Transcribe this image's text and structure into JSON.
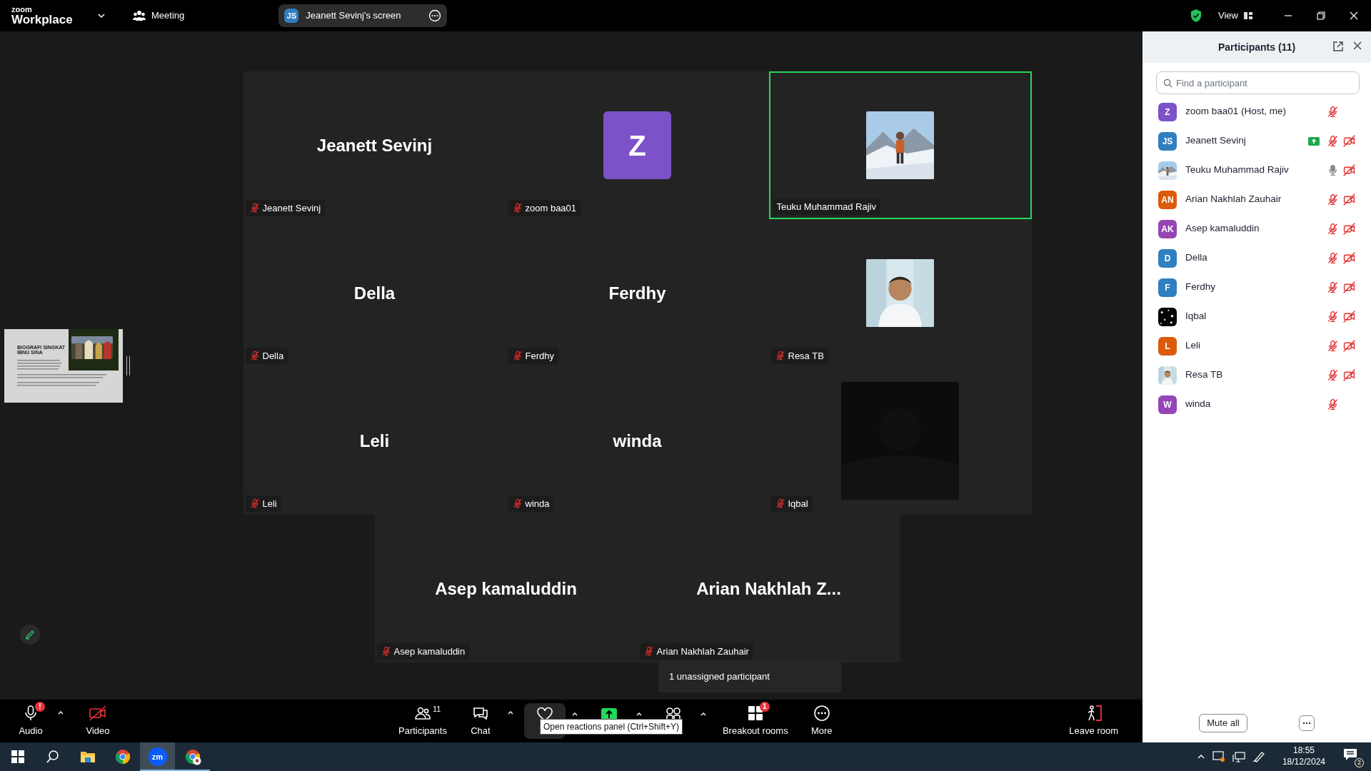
{
  "top_bar": {
    "logo_small": "zoom",
    "logo": "Workplace",
    "meeting_label": "Meeting",
    "share_pill": {
      "initials": "JS",
      "label": "Jeanett Sevinj's screen"
    },
    "view_label": "View"
  },
  "shared_slide": {
    "title": "BIOGRAFI SINGKAT IBNU SINA"
  },
  "tiles": [
    {
      "kind": "name",
      "display": "Jeanett Sevinj",
      "name": "Jeanett Sevinj",
      "muted": true,
      "speaking": false
    },
    {
      "kind": "avatar",
      "initial": "Z",
      "color": "#7d52c8",
      "name": "zoom baa01",
      "muted": true,
      "speaking": false
    },
    {
      "kind": "picture",
      "name": "Teuku Muhammad Rajiv",
      "muted": false,
      "speaking": true
    },
    {
      "kind": "name",
      "display": "Della",
      "name": "Della",
      "muted": true,
      "speaking": false
    },
    {
      "kind": "name",
      "display": "Ferdhy",
      "name": "Ferdhy",
      "muted": true,
      "speaking": false
    },
    {
      "kind": "picture",
      "name": "Resa TB",
      "muted": true,
      "speaking": false
    },
    {
      "kind": "name",
      "display": "Leli",
      "name": "Leli",
      "muted": true,
      "speaking": false
    },
    {
      "kind": "name",
      "display": "winda",
      "name": "winda",
      "muted": true,
      "speaking": false
    },
    {
      "kind": "video",
      "name": "Iqbal",
      "muted": true,
      "speaking": false
    },
    {
      "kind": "name",
      "display": "Asep kamaluddin",
      "name": "Asep kamaluddin",
      "muted": true,
      "speaking": false
    },
    {
      "kind": "name",
      "display": "Arian Nakhlah Z...",
      "name": "Arian Nakhlah Zauhair",
      "muted": true,
      "speaking": false
    }
  ],
  "unassigned_tooltip": "1 unassigned participant",
  "toolbar": {
    "items": [
      {
        "kind": "audio",
        "label": "Audio",
        "badge": "!",
        "caret": true,
        "hovered": false
      },
      {
        "kind": "video",
        "label": "Video",
        "caret": false,
        "hovered": false
      },
      {
        "kind": "participants",
        "label": "Participants",
        "count": "11",
        "caret": false,
        "hovered": false
      },
      {
        "kind": "chat",
        "label": "Chat",
        "caret": true,
        "hovered": false
      },
      {
        "kind": "reactions",
        "caret": true,
        "hovered": true
      },
      {
        "kind": "share",
        "caret": true,
        "hovered": false
      },
      {
        "kind": "apps",
        "caret": true,
        "hovered": false
      },
      {
        "kind": "breakout",
        "label": "Breakout rooms",
        "badge": "1",
        "caret": false,
        "hovered": false
      },
      {
        "kind": "more",
        "label": "More",
        "caret": false,
        "hovered": false
      }
    ],
    "leave_label": "Leave room",
    "hover_tooltip": "Open reactions panel (Ctrl+Shift+Y)"
  },
  "panel": {
    "title": "Participants (11)",
    "search_placeholder": "Find a participant",
    "participants": [
      {
        "kind": "initials",
        "initials": "Z",
        "color": "#7d52c8",
        "name": "zoom baa01 (Host, me)",
        "sharing": false,
        "mic_muted": true,
        "video_off": false
      },
      {
        "kind": "initials",
        "initials": "JS",
        "color": "#2f7fc1",
        "name": "Jeanett Sevinj",
        "sharing": true,
        "mic_muted": true,
        "video_off": true
      },
      {
        "kind": "picture",
        "name": "Teuku Muhammad Rajiv",
        "sharing": false,
        "mic_muted": false,
        "video_off": true
      },
      {
        "kind": "initials",
        "initials": "AN",
        "color": "#dc5a0c",
        "name": "Arian Nakhlah Zauhair",
        "sharing": false,
        "mic_muted": true,
        "video_off": true
      },
      {
        "kind": "initials",
        "initials": "AK",
        "color": "#9545b5",
        "name": "Asep kamaluddin",
        "sharing": false,
        "mic_muted": true,
        "video_off": true
      },
      {
        "kind": "initials",
        "initials": "D",
        "color": "#2f7fc1",
        "name": "Della",
        "sharing": false,
        "mic_muted": true,
        "video_off": true
      },
      {
        "kind": "initials",
        "initials": "F",
        "color": "#2f7fc1",
        "name": "Ferdhy",
        "sharing": false,
        "mic_muted": true,
        "video_off": true
      },
      {
        "kind": "picture",
        "name": "Iqbal",
        "sharing": false,
        "mic_muted": true,
        "video_off": true
      },
      {
        "kind": "initials",
        "initials": "L",
        "color": "#dc5a0c",
        "name": "Leli",
        "sharing": false,
        "mic_muted": true,
        "video_off": true
      },
      {
        "kind": "picture",
        "name": "Resa TB",
        "sharing": false,
        "mic_muted": true,
        "video_off": true
      },
      {
        "kind": "initials",
        "initials": "W",
        "color": "#9545b5",
        "name": "winda",
        "sharing": false,
        "mic_muted": true,
        "video_off": false
      }
    ],
    "mute_all": "Mute all"
  },
  "taskbar": {
    "apps": [
      {
        "kind": "start",
        "running": false,
        "selected": false
      },
      {
        "kind": "search",
        "running": false,
        "selected": false
      },
      {
        "kind": "explorer",
        "running": false,
        "selected": false
      },
      {
        "kind": "chrome",
        "running": false,
        "selected": false
      },
      {
        "kind": "zoom",
        "label": "zm",
        "running": true,
        "selected": true
      },
      {
        "kind": "chrome-profile",
        "running": true,
        "selected": false
      }
    ],
    "time": "18:55",
    "date": "18/12/2024",
    "notifications": "2"
  }
}
